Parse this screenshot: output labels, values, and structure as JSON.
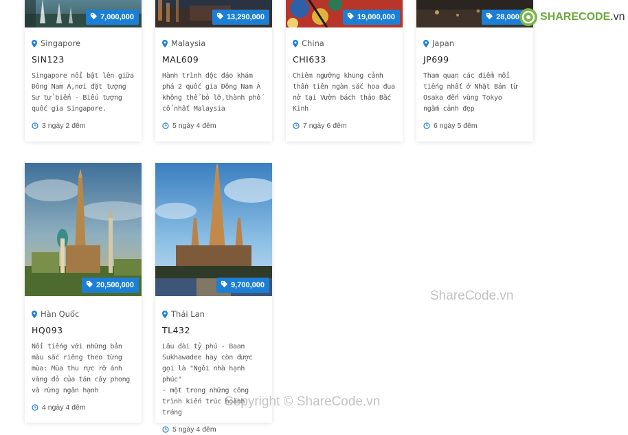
{
  "logo": {
    "brand": "SHARECODE",
    "suffix": ".vn"
  },
  "watermarks": {
    "center": "ShareCode.vn",
    "bottom": "Copyright © ShareCode.vn"
  },
  "colors": {
    "accent": "#1c7fd6"
  },
  "tours": [
    {
      "country": "Singapore",
      "code": "SIN123",
      "price": "7,000,000",
      "desc": [
        "Singapore nổi bật lên giữa",
        "Đông Nam Á,nơi đặt tượng",
        "Sư tử biển - Biểu tượng",
        "quốc gia Singapore."
      ],
      "duration": "3 ngày 2 đêm"
    },
    {
      "country": "Malaysia",
      "code": "MAL609",
      "price": "13,290,000",
      "desc": [
        "Hành trình độc đáo khám",
        "phá 2 quốc gia Đông Nam Á",
        "không thể bỏ lỡ,thành phố",
        "cổ nhất Malaysia"
      ],
      "duration": "5 ngày 4 đêm"
    },
    {
      "country": "China",
      "code": "CHI633",
      "price": "19,000,000",
      "desc": [
        "Chiêm ngưỡng khung cảnh",
        "thần tiên ngàn sắc hoa đua",
        "nở tại Vườn bách thảo Bắc",
        "Kinh"
      ],
      "duration": "7 ngày 6 đêm"
    },
    {
      "country": "Japan",
      "code": "JP699",
      "price": "28,000,0",
      "desc": [
        "Tham quan các điểm nổi",
        "tiếng nhất ở Nhật Bản từ",
        "Osaka đến vùng Tokyo",
        "ngắm cảnh đẹp"
      ],
      "duration": "6 ngày 5 đêm"
    },
    {
      "country": "Hàn Quốc",
      "code": "HQ093",
      "price": "20,500,000",
      "desc": [
        "Nổi tiếng với những bản",
        "màu sắc riêng theo từng",
        "mùa: Mùa thu rực rỡ ánh",
        "vàng đỏ của tán cây phong",
        "và rừng ngân hạnh"
      ],
      "duration": "4 ngày 4 đêm"
    },
    {
      "country": "Thái Lan",
      "code": "TL432",
      "price": "9,700,000",
      "desc": [
        "Lâu đài tỷ phú - Baan",
        "Sukhawadee hay còn được",
        "gọi là \"Ngôi nhà hạnh phúc\"",
        "- một trong những công",
        "trình kiến trúc hoành tráng"
      ],
      "duration": "5 ngày 4 đêm"
    }
  ]
}
